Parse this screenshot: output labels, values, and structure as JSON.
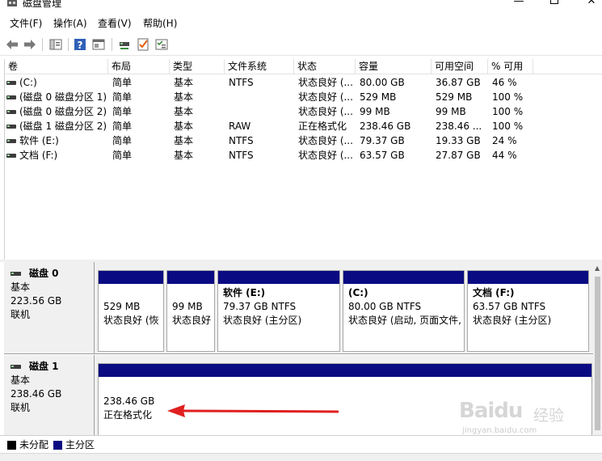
{
  "window": {
    "title": "磁盘管理",
    "minimize_glyph": "—",
    "close_glyph": "✕"
  },
  "menu": [
    "文件(F)",
    "操作(A)",
    "查看(V)",
    "帮助(H)"
  ],
  "toolbar": {
    "icons": [
      "back-arrow-icon",
      "forward-arrow-icon",
      "console-tree-icon",
      "help-icon",
      "properties-icon",
      "connect-icon",
      "check-icon",
      "settings-icon"
    ]
  },
  "columns": [
    "卷",
    "布局",
    "类型",
    "文件系统",
    "状态",
    "容量",
    "可用空间",
    "% 可用"
  ],
  "volumes": [
    {
      "name": "(C:)",
      "layout": "简单",
      "type": "基本",
      "fs": "NTFS",
      "status": "状态良好 (...",
      "capacity": "80.00 GB",
      "free": "36.87 GB",
      "pct": "46 %"
    },
    {
      "name": "(磁盘 0 磁盘分区 1)",
      "layout": "简单",
      "type": "基本",
      "fs": "",
      "status": "状态良好 (...",
      "capacity": "529 MB",
      "free": "529 MB",
      "pct": "100 %"
    },
    {
      "name": "(磁盘 0 磁盘分区 2)",
      "layout": "简单",
      "type": "基本",
      "fs": "",
      "status": "状态良好 (...",
      "capacity": "99 MB",
      "free": "99 MB",
      "pct": "100 %"
    },
    {
      "name": "(磁盘 1 磁盘分区 2)",
      "layout": "简单",
      "type": "基本",
      "fs": "RAW",
      "status": "正在格式化",
      "capacity": "238.46 GB",
      "free": "238.46 ...",
      "pct": "100 %"
    },
    {
      "name": "软件 (E:)",
      "layout": "简单",
      "type": "基本",
      "fs": "NTFS",
      "status": "状态良好 (...",
      "capacity": "79.37 GB",
      "free": "19.33 GB",
      "pct": "24 %"
    },
    {
      "name": "文档 (F:)",
      "layout": "简单",
      "type": "基本",
      "fs": "NTFS",
      "status": "状态良好 (...",
      "capacity": "63.57 GB",
      "free": "27.87 GB",
      "pct": "44 %"
    }
  ],
  "disks": [
    {
      "name": "磁盘 0",
      "type": "基本",
      "size": "223.56 GB",
      "state": "联机",
      "partitions": [
        {
          "title": "",
          "size": "529 MB",
          "status": "状态良好 (恢"
        },
        {
          "title": "",
          "size": "99 MB",
          "status": "状态良好"
        },
        {
          "title": "软件   (E:)",
          "size": "79.37 GB NTFS",
          "status": "状态良好 (主分区)"
        },
        {
          "title": "(C:)",
          "size": "80.00 GB NTFS",
          "status": "状态良好 (启动, 页面文件,"
        },
        {
          "title": "文档   (F:)",
          "size": "63.57 GB NTFS",
          "status": "状态良好 (主分区)"
        }
      ]
    },
    {
      "name": "磁盘 1",
      "type": "基本",
      "size": "238.46 GB",
      "state": "联机",
      "partitions": [
        {
          "title": "",
          "size": "238.46 GB",
          "status": "正在格式化"
        }
      ]
    }
  ],
  "legend": [
    {
      "label": "未分配",
      "color": "#000000"
    },
    {
      "label": "主分区",
      "color": "#0a0a82"
    }
  ],
  "colors": {
    "primary_partition": "#0a0a82",
    "annotation_arrow": "#e02020"
  },
  "watermark": {
    "brand": "Baidu",
    "cn": "经验",
    "url": "jingyan.baidu.com"
  }
}
